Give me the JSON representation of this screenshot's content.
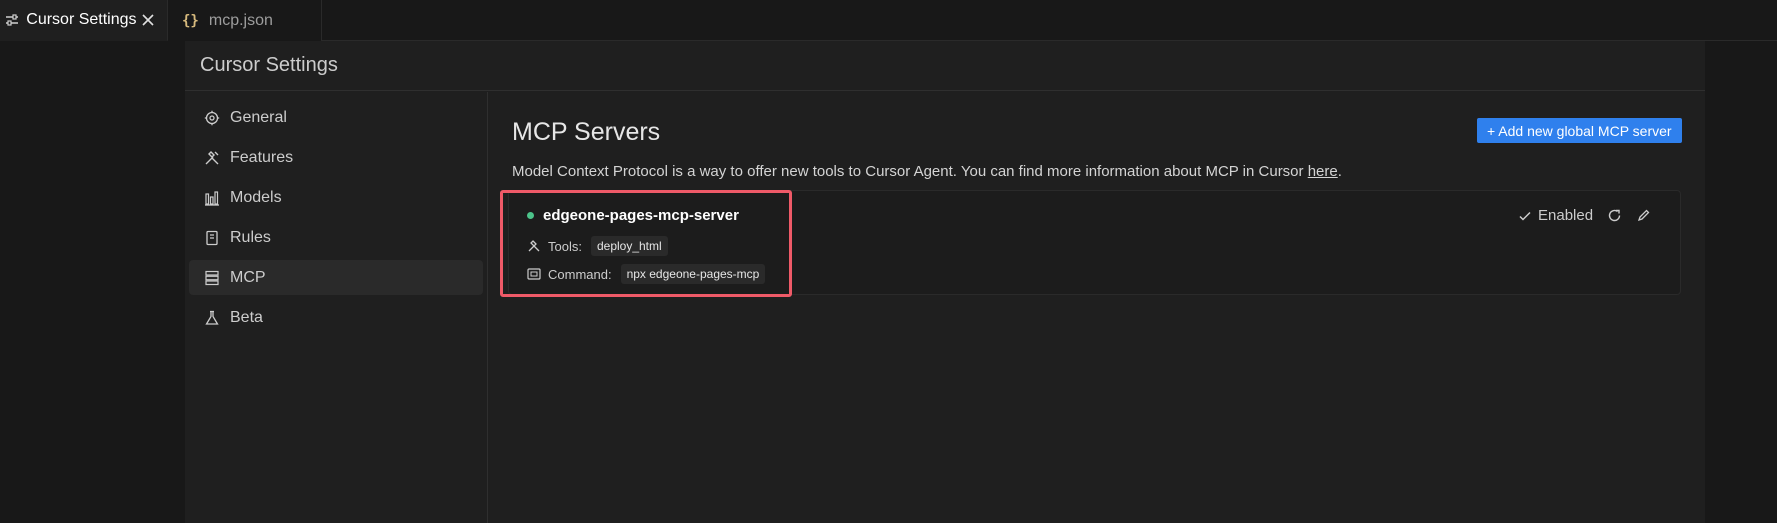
{
  "tabs": [
    {
      "label": "Cursor Settings",
      "icon": "sliders-icon",
      "active": true
    },
    {
      "label": "mcp.json",
      "icon": "braces-icon",
      "active": false
    }
  ],
  "settings": {
    "title": "Cursor Settings",
    "nav": [
      {
        "label": "General",
        "icon": "gear-icon"
      },
      {
        "label": "Features",
        "icon": "tools-icon"
      },
      {
        "label": "Models",
        "icon": "bar-chart-icon"
      },
      {
        "label": "Rules",
        "icon": "book-icon"
      },
      {
        "label": "MCP",
        "icon": "server-stack-icon",
        "active": true
      },
      {
        "label": "Beta",
        "icon": "flask-icon"
      }
    ]
  },
  "mcp": {
    "title": "MCP Servers",
    "add_button": "+ Add new global MCP server",
    "description": "Model Context Protocol is a way to offer new tools to Cursor Agent. You can find more information about MCP in Cursor",
    "link_text": "here",
    "period": ".",
    "server": {
      "name": "edgeone-pages-mcp-server",
      "tools_label": "Tools:",
      "tool": "deploy_html",
      "command_label": "Command:",
      "command": "npx edgeone-pages-mcp",
      "enabled_label": "Enabled",
      "status_color": "#4cc38a"
    }
  },
  "colors": {
    "accent": "#2f80ed",
    "highlight": "#ef5a68"
  }
}
